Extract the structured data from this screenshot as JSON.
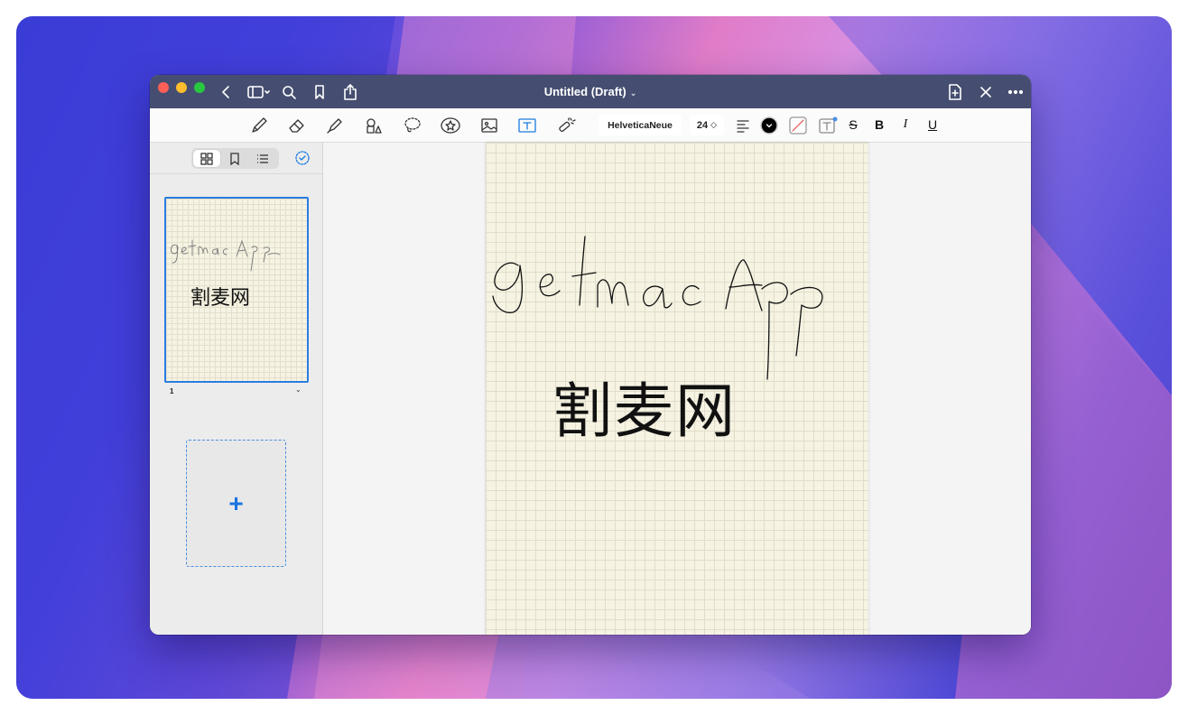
{
  "window": {
    "title": "Untitled (Draft)",
    "title_chevron": "⌄"
  },
  "titlebar_icons": [
    "back-icon",
    "sidebar-toggle-icon",
    "search-icon",
    "bookmark-icon",
    "share-icon",
    "new-page-icon",
    "close-icon",
    "more-icon"
  ],
  "toolbar": {
    "tools": [
      "pen",
      "eraser",
      "highlighter",
      "shapes",
      "lasso",
      "sticker",
      "image",
      "text",
      "laser-pointer"
    ],
    "active_tool": "text",
    "font_name": "HelveticaNeue",
    "font_size": "24",
    "stepper_glyph": "◇",
    "strikethrough": "S",
    "bold": "B",
    "italic": "I",
    "underline": "U",
    "text_color": "#000000"
  },
  "sidebar": {
    "views": [
      "thumbnails",
      "bookmarks",
      "outline"
    ],
    "selected_view": "thumbnails",
    "pages": [
      {
        "number": "1",
        "text": "割麦网",
        "chevron": "⌄"
      }
    ],
    "add_page_label": "+"
  },
  "canvas": {
    "handwriting": "getmacApp",
    "text": "割麦网"
  },
  "colors": {
    "titlebar": "#454e70",
    "accent": "#1a7be0",
    "paper": "#f6f3e3"
  }
}
